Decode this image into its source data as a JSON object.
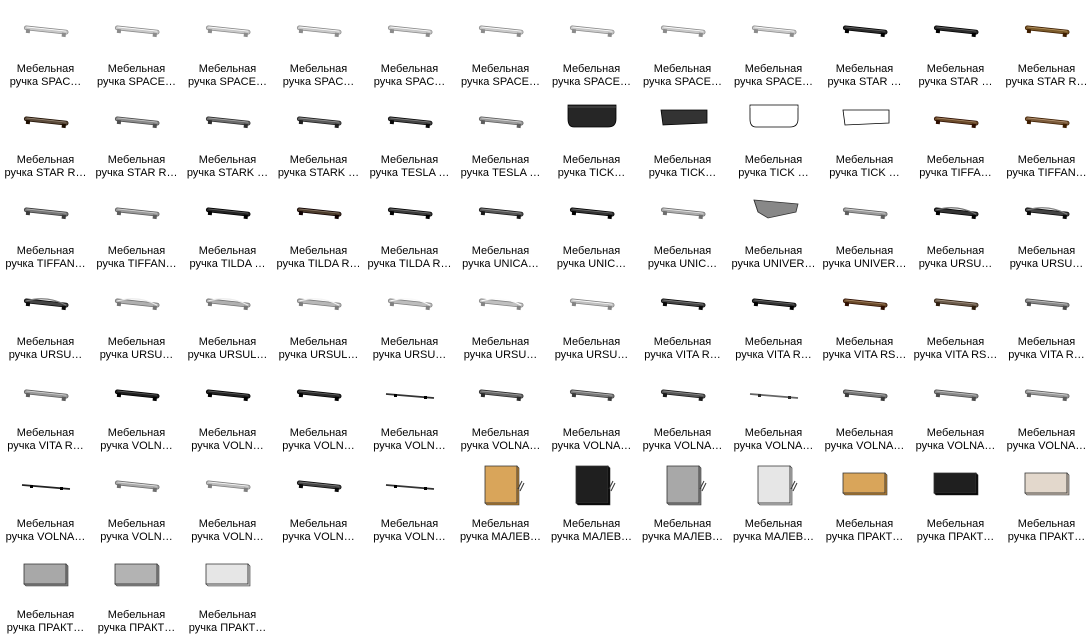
{
  "view": {
    "columns": 12,
    "items": [
      {
        "line1": "Мебельная",
        "line2": "ручка SPAC…",
        "icon": "handle-bar-icon",
        "color": "#c8c8c8"
      },
      {
        "line1": "Мебельная",
        "line2": "ручка SPACE…",
        "icon": "handle-bar-icon",
        "color": "#c8c8c8"
      },
      {
        "line1": "Мебельная",
        "line2": "ручка SPACE…",
        "icon": "handle-bar-icon",
        "color": "#c8c8c8"
      },
      {
        "line1": "Мебельная",
        "line2": "ручка SPAC…",
        "icon": "handle-bar-icon",
        "color": "#c8c8c8"
      },
      {
        "line1": "Мебельная",
        "line2": "ручка SPAC…",
        "icon": "handle-bar-icon",
        "color": "#c8c8c8"
      },
      {
        "line1": "Мебельная",
        "line2": "ручка SPACE…",
        "icon": "handle-bar-icon",
        "color": "#c8c8c8"
      },
      {
        "line1": "Мебельная",
        "line2": "ручка SPACE…",
        "icon": "handle-bar-icon",
        "color": "#c8c8c8"
      },
      {
        "line1": "Мебельная",
        "line2": "ручка SPACE…",
        "icon": "handle-bar-icon",
        "color": "#c8c8c8"
      },
      {
        "line1": "Мебельная",
        "line2": "ручка SPACE…",
        "icon": "handle-bar-icon",
        "color": "#c8c8c8"
      },
      {
        "line1": "Мебельная",
        "line2": "ручка STAR …",
        "icon": "handle-bar-icon",
        "color": "#2a2a2a"
      },
      {
        "line1": "Мебельная",
        "line2": "ручка STAR …",
        "icon": "handle-bar-icon",
        "color": "#2a2a2a"
      },
      {
        "line1": "Мебельная",
        "line2": "ручка STAR R…",
        "icon": "handle-bar-icon",
        "color": "#7a5a2a"
      },
      {
        "line1": "Мебельная",
        "line2": "ручка STAR R…",
        "icon": "handle-bar-icon",
        "color": "#5a4a3a"
      },
      {
        "line1": "Мебельная",
        "line2": "ручка STAR R…",
        "icon": "handle-bar-icon",
        "color": "#8a8a8a"
      },
      {
        "line1": "Мебельная",
        "line2": "ручка STARK …",
        "icon": "handle-bar-icon",
        "color": "#6a6a6a"
      },
      {
        "line1": "Мебельная",
        "line2": "ручка STARK …",
        "icon": "handle-bar-icon",
        "color": "#5a5a5a"
      },
      {
        "line1": "Мебельная",
        "line2": "ручка TESLA …",
        "icon": "handle-bar-icon",
        "color": "#444444"
      },
      {
        "line1": "Мебельная",
        "line2": "ручка TESLA …",
        "icon": "handle-bar-icon",
        "color": "#9a9a9a"
      },
      {
        "line1": "Мебельная",
        "line2": "ручка TICK…",
        "icon": "handle-block-icon",
        "color": "#262626"
      },
      {
        "line1": "Мебельная",
        "line2": "ручка TICK…",
        "icon": "handle-flat-icon",
        "color": "#333333"
      },
      {
        "line1": "Мебельная",
        "line2": "ручка TICK …",
        "icon": "handle-block-icon",
        "color": "#ffffff"
      },
      {
        "line1": "Мебельная",
        "line2": "ручка TICK …",
        "icon": "handle-flat-icon",
        "color": "#ffffff"
      },
      {
        "line1": "Мебельная",
        "line2": "ручка TIFFA…",
        "icon": "handle-bar-icon",
        "color": "#6a4a2a"
      },
      {
        "line1": "Мебельная",
        "line2": "ручка TIFFAN…",
        "icon": "handle-bar-icon",
        "color": "#7a5a3a"
      },
      {
        "line1": "Мебельная",
        "line2": "ручка TIFFAN…",
        "icon": "handle-bar-icon",
        "color": "#777777"
      },
      {
        "line1": "Мебельная",
        "line2": "ручка TIFFAN…",
        "icon": "handle-bar-icon",
        "color": "#999999"
      },
      {
        "line1": "Мебельная",
        "line2": "ручка TILDA …",
        "icon": "handle-bar-icon",
        "color": "#222222"
      },
      {
        "line1": "Мебельная",
        "line2": "ручка TILDA R…",
        "icon": "handle-bar-icon",
        "color": "#4a3a2a"
      },
      {
        "line1": "Мебельная",
        "line2": "ручка TILDA R…",
        "icon": "handle-bar-icon",
        "color": "#3a3a3a"
      },
      {
        "line1": "Мебельная",
        "line2": "ручка UNICA…",
        "icon": "handle-bar-icon",
        "color": "#555555"
      },
      {
        "line1": "Мебельная",
        "line2": "ручка UNIC…",
        "icon": "handle-bar-icon",
        "color": "#333333"
      },
      {
        "line1": "Мебельная",
        "line2": "ручка UNIC…",
        "icon": "handle-bar-icon",
        "color": "#aaaaaa"
      },
      {
        "line1": "Мебельная",
        "line2": "ручка UNIVER…",
        "icon": "handle-wedge-icon",
        "color": "#888888"
      },
      {
        "line1": "Мебельная",
        "line2": "ручка UNIVER…",
        "icon": "handle-bar-icon",
        "color": "#9a9a9a"
      },
      {
        "line1": "Мебельная",
        "line2": "ручка URSU…",
        "icon": "handle-arch-icon",
        "color": "#333333"
      },
      {
        "line1": "Мебельная",
        "line2": "ручка URSU…",
        "icon": "handle-arch-icon",
        "color": "#444444"
      },
      {
        "line1": "Мебельная",
        "line2": "ручка URSU…",
        "icon": "handle-arch-icon",
        "color": "#444444"
      },
      {
        "line1": "Мебельная",
        "line2": "ручка URSU…",
        "icon": "handle-arch-icon",
        "color": "#b0b0b0"
      },
      {
        "line1": "Мебельная",
        "line2": "ручка URSUL…",
        "icon": "handle-arch-icon",
        "color": "#b0b0b0"
      },
      {
        "line1": "Мебельная",
        "line2": "ручка URSUL…",
        "icon": "handle-arch-icon",
        "color": "#b8b8b8"
      },
      {
        "line1": "Мебельная",
        "line2": "ручка URSU…",
        "icon": "handle-arch-icon",
        "color": "#bdbdbd"
      },
      {
        "line1": "Мебельная",
        "line2": "ручка URSU…",
        "icon": "handle-arch-icon",
        "color": "#c0c0c0"
      },
      {
        "line1": "Мебельная",
        "line2": "ручка URSU…",
        "icon": "handle-bar-icon",
        "color": "#c0c0c0"
      },
      {
        "line1": "Мебельная",
        "line2": "ручка VITA R…",
        "icon": "handle-bar-icon",
        "color": "#444444"
      },
      {
        "line1": "Мебельная",
        "line2": "ручка VITA R…",
        "icon": "handle-bar-icon",
        "color": "#333333"
      },
      {
        "line1": "Мебельная",
        "line2": "ручка VITA RS…",
        "icon": "handle-bar-icon",
        "color": "#6a4a2a"
      },
      {
        "line1": "Мебельная",
        "line2": "ручка VITA RS…",
        "icon": "handle-bar-icon",
        "color": "#6a5a4a"
      },
      {
        "line1": "Мебельная",
        "line2": "ручка VITA R…",
        "icon": "handle-bar-icon",
        "color": "#888888"
      },
      {
        "line1": "Мебельная",
        "line2": "ручка VITA R…",
        "icon": "handle-bar-icon",
        "color": "#999999"
      },
      {
        "line1": "Мебельная",
        "line2": "ручка VOLN…",
        "icon": "handle-bar-icon",
        "color": "#1e1e1e"
      },
      {
        "line1": "Мебельная",
        "line2": "ручка VOLN…",
        "icon": "handle-bar-icon",
        "color": "#222222"
      },
      {
        "line1": "Мебельная",
        "line2": "ручка VOLN…",
        "icon": "handle-bar-icon",
        "color": "#2a2a2a"
      },
      {
        "line1": "Мебельная",
        "line2": "ручка VOLN…",
        "icon": "handle-rod-icon",
        "color": "#333333"
      },
      {
        "line1": "Мебельная",
        "line2": "ручка VOLNA…",
        "icon": "handle-bar-icon",
        "color": "#666666"
      },
      {
        "line1": "Мебельная",
        "line2": "ручка VOLNA…",
        "icon": "handle-bar-icon",
        "color": "#777777"
      },
      {
        "line1": "Мебельная",
        "line2": "ручка VOLNA…",
        "icon": "handle-bar-icon",
        "color": "#555555"
      },
      {
        "line1": "Мебельная",
        "line2": "ручка VOLNA…",
        "icon": "handle-rod-icon",
        "color": "#666666"
      },
      {
        "line1": "Мебельная",
        "line2": "ручка VOLNA…",
        "icon": "handle-bar-icon",
        "color": "#777777"
      },
      {
        "line1": "Мебельная",
        "line2": "ручка VOLNA…",
        "icon": "handle-bar-icon",
        "color": "#888888"
      },
      {
        "line1": "Мебельная",
        "line2": "ручка VOLNA…",
        "icon": "handle-bar-icon",
        "color": "#999999"
      },
      {
        "line1": "Мебельная",
        "line2": "ручка VOLNA…",
        "icon": "handle-rod-icon",
        "color": "#222222"
      },
      {
        "line1": "Мебельная",
        "line2": "ручка VOLN…",
        "icon": "handle-bar-icon",
        "color": "#aaaaaa"
      },
      {
        "line1": "Мебельная",
        "line2": "ручка VOLN…",
        "icon": "handle-bar-icon",
        "color": "#bbbbbb"
      },
      {
        "line1": "Мебельная",
        "line2": "ручка VOLN…",
        "icon": "handle-bar-icon",
        "color": "#444444"
      },
      {
        "line1": "Мебельная",
        "line2": "ручка VOLN…",
        "icon": "handle-rod-icon",
        "color": "#333333"
      },
      {
        "line1": "Мебельная",
        "line2": "ручка МАЛЕВ…",
        "icon": "panel-square-icon",
        "color": "#d9a55a"
      },
      {
        "line1": "Мебельная",
        "line2": "ручка МАЛЕВ…",
        "icon": "panel-square-icon",
        "color": "#1f1f1f"
      },
      {
        "line1": "Мебельная",
        "line2": "ручка МАЛЕВ…",
        "icon": "panel-square-icon",
        "color": "#a8a8a8"
      },
      {
        "line1": "Мебельная",
        "line2": "ручка МАЛЕВ…",
        "icon": "panel-square-icon",
        "color": "#e6e6e6"
      },
      {
        "line1": "Мебельная",
        "line2": "ручка ПРАКТ…",
        "icon": "panel-wide-icon",
        "color": "#d9a55a"
      },
      {
        "line1": "Мебельная",
        "line2": "ручка ПРАКТ…",
        "icon": "panel-wide-icon",
        "color": "#1f1f1f"
      },
      {
        "line1": "Мебельная",
        "line2": "ручка ПРАКТ…",
        "icon": "panel-wide-icon",
        "color": "#e3d8cc"
      },
      {
        "line1": "Мебельная",
        "line2": "ручка ПРАКТ…",
        "icon": "panel-wide-icon",
        "color": "#a8a8a8"
      },
      {
        "line1": "Мебельная",
        "line2": "ручка ПРАКТ…",
        "icon": "panel-wide-icon",
        "color": "#b3b3b3"
      },
      {
        "line1": "Мебельная",
        "line2": "ручка ПРАКТ…",
        "icon": "panel-wide-icon",
        "color": "#e6e6e6"
      }
    ]
  }
}
